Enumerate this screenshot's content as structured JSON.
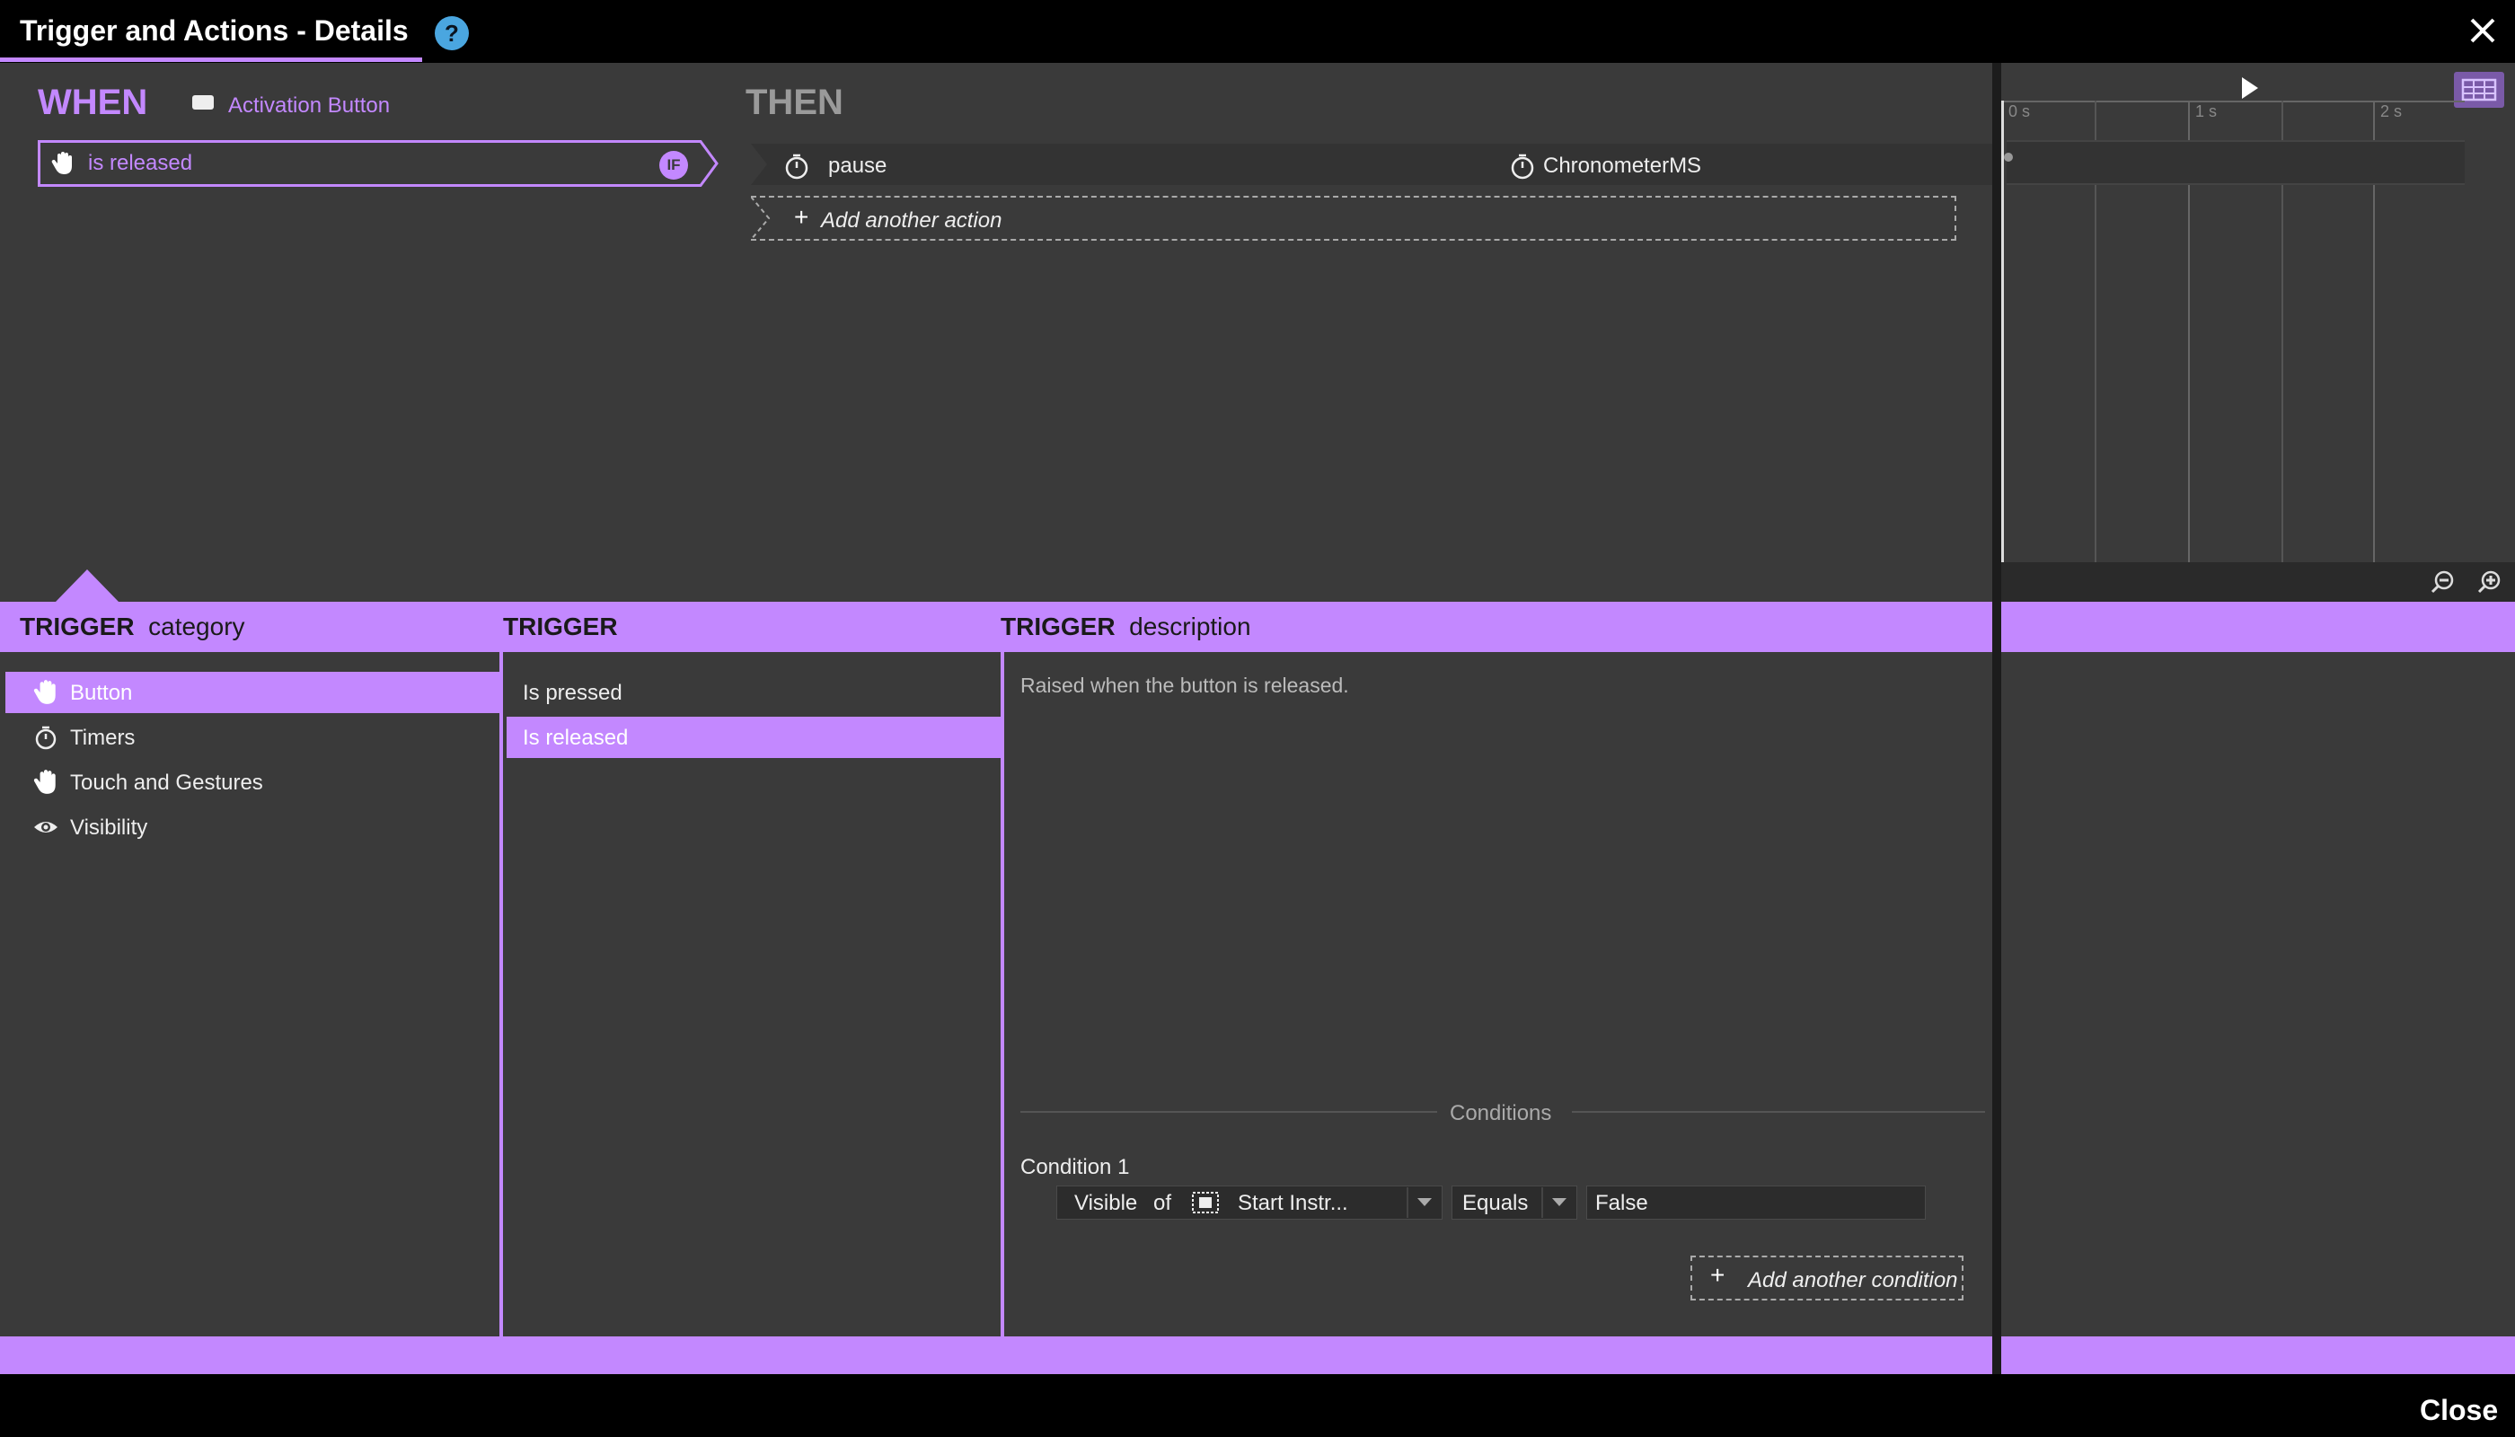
{
  "window": {
    "title": "Trigger and Actions - Details",
    "help": "?",
    "accent_color": "#c388ff",
    "background_color": "#3a3a3a"
  },
  "when": {
    "label": "WHEN",
    "source_icon": "button-icon",
    "source_label": "Activation Button",
    "trigger_icon": "hand-icon",
    "trigger_text": "is released",
    "badge": "IF"
  },
  "then": {
    "label": "THEN",
    "actions": [
      {
        "icon": "stopwatch-icon",
        "name": "pause",
        "target_icon": "stopwatch-icon",
        "target": "ChronometerMS"
      }
    ],
    "add_action_label": "Add another action"
  },
  "timeline": {
    "ticks": [
      "0 s",
      "1 s",
      "2 s"
    ]
  },
  "headers": {
    "category_bold": "TRIGGER",
    "category_rest": "category",
    "trigger_bold": "TRIGGER",
    "description_bold": "TRIGGER",
    "description_rest": "description"
  },
  "categories": [
    {
      "icon": "hand-icon",
      "label": "Button",
      "selected": true
    },
    {
      "icon": "stopwatch-icon",
      "label": "Timers",
      "selected": false
    },
    {
      "icon": "hand-icon",
      "label": "Touch and Gestures",
      "selected": false
    },
    {
      "icon": "eye-icon",
      "label": "Visibility",
      "selected": false
    }
  ],
  "triggers": [
    {
      "label": "Is pressed",
      "selected": false
    },
    {
      "label": "Is released",
      "selected": true
    }
  ],
  "description": "Raised when the button is released.",
  "conditions": {
    "title": "Conditions",
    "items": [
      {
        "label": "Condition 1",
        "property": "Visible",
        "of": "of",
        "object_icon": "frame-icon",
        "object": "Start Instr...",
        "operator": "Equals",
        "value": "False"
      }
    ],
    "add_label": "Add another condition"
  },
  "footer": {
    "close_label": "Close"
  }
}
